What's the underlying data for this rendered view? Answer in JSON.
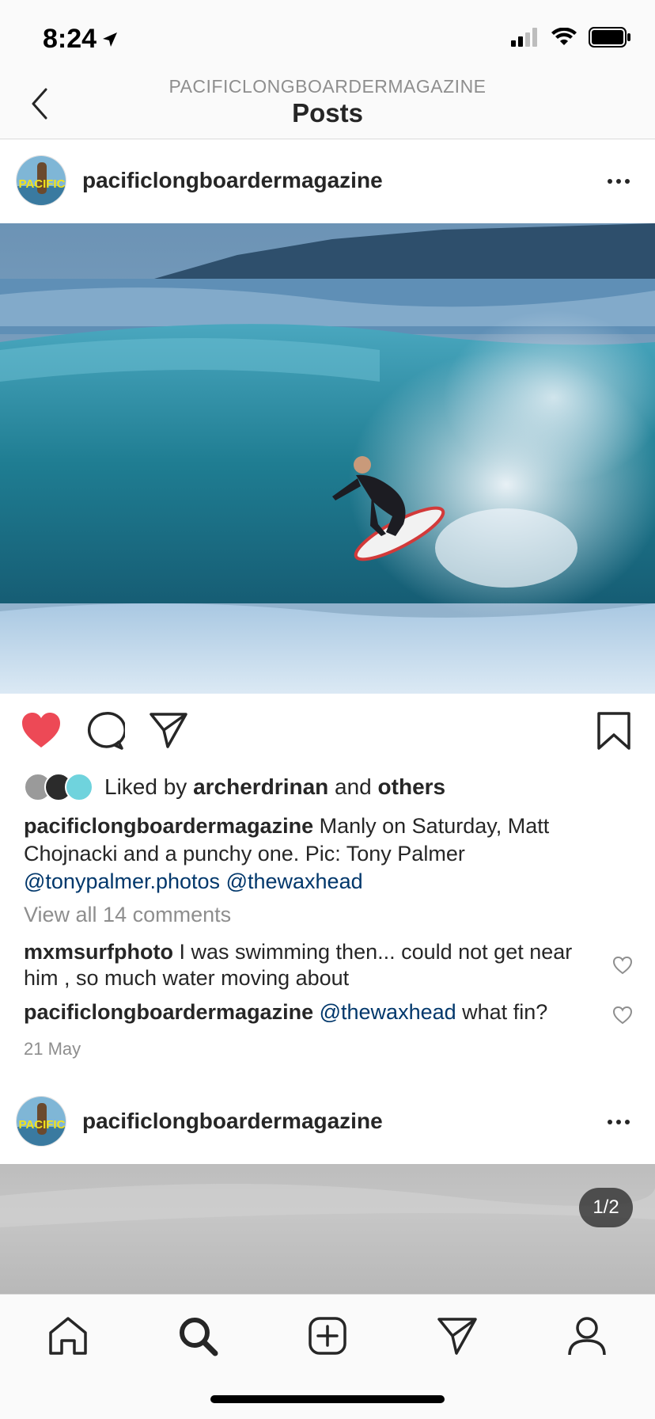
{
  "status_bar": {
    "time": "8:24"
  },
  "header": {
    "subtitle": "PACIFICLONGBOARDERMAGAZINE",
    "title": "Posts"
  },
  "post": {
    "username": "pacificlongboardermagazine",
    "liked_by_prefix": "Liked by",
    "liked_by_user": "archerdrinan",
    "liked_by_and": "and",
    "liked_by_others": "others",
    "caption_user": "pacificlongboardermagazine",
    "caption_text": "Manly on Saturday, Matt Chojnacki and a punchy one. Pic: Tony Palmer",
    "caption_mention_1": "@tonypalmer.photos",
    "caption_mention_2": "@thewaxhead",
    "view_comments": "View all 14 comments",
    "comments": [
      {
        "user": "mxmsurfphoto",
        "text": "I was swimming then... could not get near him , so much water moving about",
        "mention": ""
      },
      {
        "user": "pacificlongboardermagazine",
        "mention": "@thewaxhead",
        "text": "what fin?"
      }
    ],
    "date": "21 May",
    "liked": true
  },
  "post2": {
    "username": "pacificlongboardermagazine",
    "page_counter": "1/2"
  },
  "icons": {
    "back": "chevron-left-icon",
    "like": "heart-icon",
    "comment": "comment-bubble-icon",
    "share": "paper-plane-icon",
    "save": "bookmark-icon",
    "more": "ellipsis-icon",
    "tabs": [
      "home-icon",
      "search-icon",
      "add-post-icon",
      "direct-icon",
      "profile-icon"
    ]
  },
  "colors": {
    "like_red": "#ed4956",
    "mention_blue": "#00376b",
    "secondary_text": "#8e8e8e"
  }
}
